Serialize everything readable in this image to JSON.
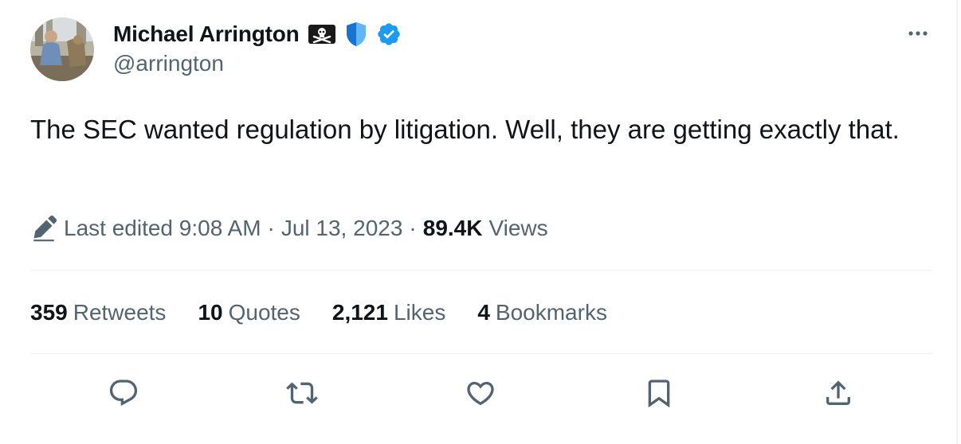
{
  "tweet": {
    "author": {
      "display_name": "Michael Arrington",
      "handle": "@arrington",
      "badges": [
        "pirate-flag-emoji",
        "blue-shield-emoji",
        "verified-badge-icon"
      ],
      "colors": {
        "verified": "#1d9bf0",
        "shield": "#1e88e5"
      }
    },
    "text": "The SEC wanted regulation by litigation. Well, they are getting exactly that.",
    "meta": {
      "edited_label": "Last edited",
      "time": "9:08 AM",
      "separator": "·",
      "date": "Jul 13, 2023",
      "views_count": "89.4K",
      "views_label": "Views"
    },
    "stats": {
      "retweets_count": "359",
      "retweets_label": "Retweets",
      "quotes_count": "10",
      "quotes_label": "Quotes",
      "likes_count": "2,121",
      "likes_label": "Likes",
      "bookmarks_count": "4",
      "bookmarks_label": "Bookmarks"
    },
    "actions": [
      "reply-icon",
      "retweet-icon",
      "like-icon",
      "bookmark-icon",
      "share-icon"
    ],
    "colors": {
      "text": "#0f1419",
      "secondary": "#536471",
      "divider": "#eff3f4"
    }
  }
}
